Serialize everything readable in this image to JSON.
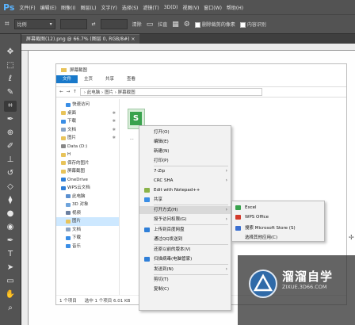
{
  "ps": {
    "logo": "Ps",
    "menus": [
      "文件(F)",
      "编辑(E)",
      "图像(I)",
      "图层(L)",
      "文字(Y)",
      "选择(S)",
      "滤镜(T)",
      "3D(D)",
      "视图(V)",
      "窗口(W)",
      "帮助(H)"
    ],
    "options": {
      "ratio": "比例",
      "swap": "⇄",
      "clear": "清除",
      "straighten": "拉直",
      "delete_cropped": "删除裁剪的像素",
      "content_aware": "内容识别"
    },
    "tab": "屏幕截图(12).png @ 66.7% (图层 0, RGB/8#) ×"
  },
  "explorer": {
    "title": "屏幕截图",
    "ribbon": [
      "文件",
      "主页",
      "共享",
      "查看"
    ],
    "address": "› 此电脑 › 图片 › 屏幕截图",
    "nav": [
      {
        "label": "快速访问",
        "icon": "star-icon"
      },
      {
        "label": "桌面",
        "icon": "folder-icon",
        "pin": "✱"
      },
      {
        "label": "下载",
        "icon": "download-icon",
        "pin": "✱"
      },
      {
        "label": "文档",
        "icon": "document-icon",
        "pin": "✱"
      },
      {
        "label": "图片",
        "icon": "folder-icon",
        "pin": "✱"
      },
      {
        "label": "Data (D:)",
        "icon": "drive-icon"
      },
      {
        "label": "H",
        "icon": "folder-icon"
      },
      {
        "label": "保存的图片",
        "icon": "folder-icon"
      },
      {
        "label": "屏幕截图",
        "icon": "folder-icon"
      },
      {
        "label": "OneDrive",
        "icon": "cloud-icon"
      },
      {
        "label": "WPS云文档",
        "icon": "cloud-icon"
      },
      {
        "label": "此电脑",
        "icon": "computer-icon"
      },
      {
        "label": "3D 对象",
        "icon": "cube-icon"
      },
      {
        "label": "视频",
        "icon": "video-icon"
      },
      {
        "label": "图片",
        "icon": "folder-icon",
        "selected": true
      },
      {
        "label": "文档",
        "icon": "document-icon"
      },
      {
        "label": "下载",
        "icon": "download-icon"
      },
      {
        "label": "音乐",
        "icon": "music-icon"
      }
    ],
    "file_label": "...",
    "status_count": "1 个项目",
    "status_selected": "选中 1 个项目 6.01 KB"
  },
  "context_menu": {
    "items": [
      {
        "label": "打开(O)"
      },
      {
        "label": "编辑(E)"
      },
      {
        "label": "新建(N)"
      },
      {
        "label": "打印(P)"
      },
      {
        "label": "7-Zip",
        "submenu": true
      },
      {
        "label": "CRC SHA",
        "submenu": true
      },
      {
        "label": "Edit with Notepad++",
        "icon": "notepad-icon"
      },
      {
        "label": "共享",
        "icon": "share-icon"
      },
      {
        "label": "打开方式(H)",
        "submenu": true,
        "highlighted": true
      },
      {
        "label": "授予访问权限(G)",
        "submenu": true
      },
      {
        "label": "上传到百度网盘",
        "icon": "cloud-icon"
      },
      {
        "label": "通过QQ发送到",
        "submenu": false
      },
      {
        "label": "还原以前的版本(V)"
      },
      {
        "label": "扫描病毒(电脑管家)",
        "icon": "shield-icon"
      },
      {
        "label": "发送到(N)",
        "submenu": true
      },
      {
        "label": "剪切(T)"
      },
      {
        "label": "复制(C)"
      }
    ]
  },
  "submenu": {
    "items": [
      {
        "label": "Excel",
        "icon": "excel-icon"
      },
      {
        "label": "WPS Office",
        "icon": "wps-icon"
      },
      {
        "label": "搜索 Microsoft Store (S)",
        "icon": "store-icon"
      },
      {
        "label": "选择其他应用(C)"
      }
    ]
  },
  "watermark": {
    "title": "溜溜自学",
    "subtitle": "ZIXUE.3D66.COM"
  },
  "colors": {
    "ps_blue": "#5ab4ff",
    "ribbon_file": "#1979ca",
    "excel_green": "#39a24d",
    "wps_red": "#d23a2b",
    "watermark_blue": "#2f6aa8"
  }
}
